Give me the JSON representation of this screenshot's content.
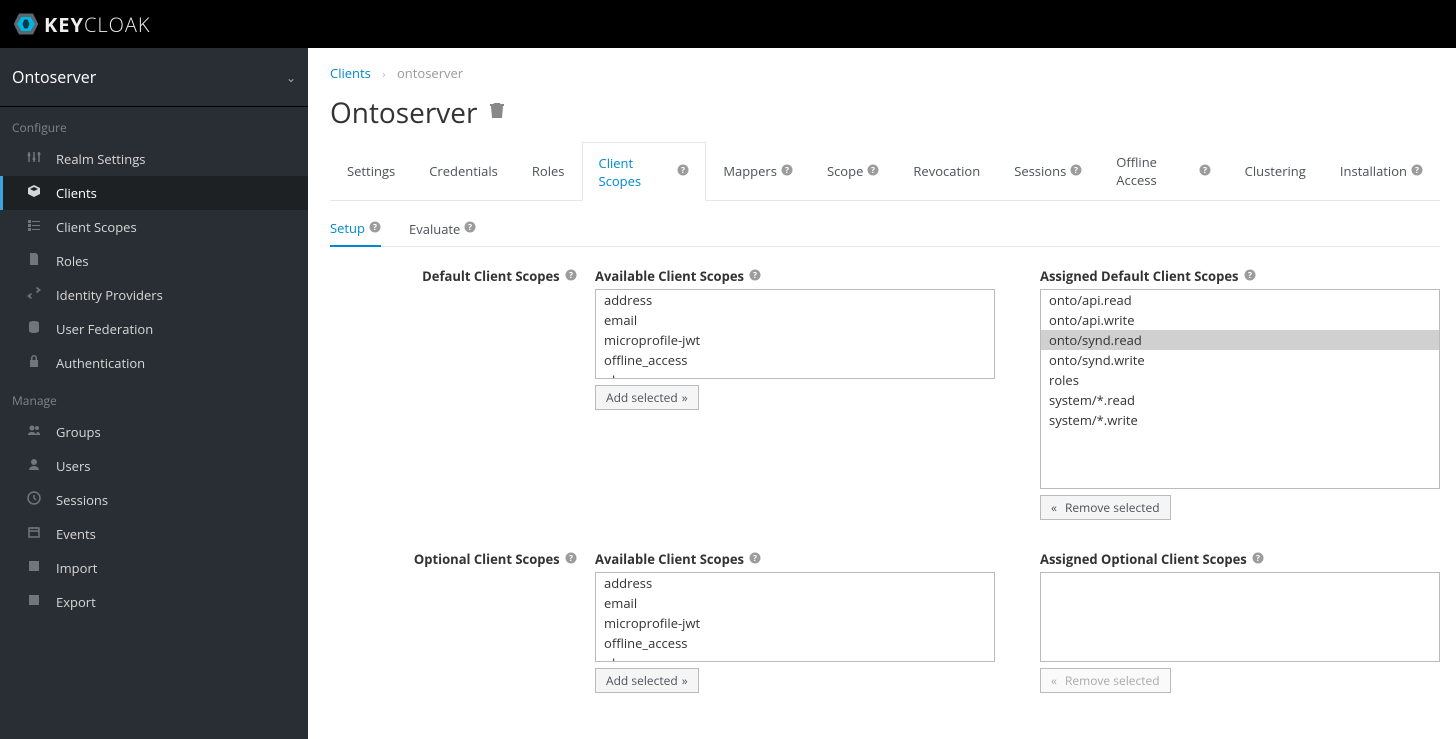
{
  "brand": {
    "text": "KEYCLOAK",
    "bold_prefix_len": 3
  },
  "realm_selector": "Ontoserver",
  "sidebar": {
    "sections": [
      {
        "label": "Configure",
        "items": [
          {
            "label": "Realm Settings",
            "icon": "sliders"
          },
          {
            "label": "Clients",
            "icon": "cube",
            "active": true
          },
          {
            "label": "Client Scopes",
            "icon": "list"
          },
          {
            "label": "Roles",
            "icon": "file"
          },
          {
            "label": "Identity Providers",
            "icon": "exchange"
          },
          {
            "label": "User Federation",
            "icon": "db"
          },
          {
            "label": "Authentication",
            "icon": "lock"
          }
        ]
      },
      {
        "label": "Manage",
        "items": [
          {
            "label": "Groups",
            "icon": "users"
          },
          {
            "label": "Users",
            "icon": "user"
          },
          {
            "label": "Sessions",
            "icon": "clock"
          },
          {
            "label": "Events",
            "icon": "calendar"
          },
          {
            "label": "Import",
            "icon": "import"
          },
          {
            "label": "Export",
            "icon": "export"
          }
        ]
      }
    ]
  },
  "breadcrumb": {
    "parent": "Clients",
    "current": "ontoserver"
  },
  "page_title": "Ontoserver",
  "tabs": [
    {
      "label": "Settings"
    },
    {
      "label": "Credentials"
    },
    {
      "label": "Roles"
    },
    {
      "label": "Client Scopes",
      "help": true,
      "active": true
    },
    {
      "label": "Mappers",
      "help": true
    },
    {
      "label": "Scope",
      "help": true
    },
    {
      "label": "Revocation"
    },
    {
      "label": "Sessions",
      "help": true
    },
    {
      "label": "Offline Access",
      "help": true
    },
    {
      "label": "Clustering"
    },
    {
      "label": "Installation",
      "help": true
    }
  ],
  "subtabs": [
    {
      "label": "Setup",
      "help": true,
      "active": true
    },
    {
      "label": "Evaluate",
      "help": true
    }
  ],
  "scope_rows": [
    {
      "label": "Default Client Scopes",
      "available": {
        "title": "Available Client Scopes",
        "options": [
          "address",
          "email",
          "microprofile-jwt",
          "offline_access",
          "phone"
        ],
        "button": "Add selected",
        "tall": false
      },
      "assigned": {
        "title": "Assigned Default Client Scopes",
        "options": [
          "onto/api.read",
          "onto/api.write",
          "onto/synd.read",
          "onto/synd.write",
          "roles",
          "system/*.read",
          "system/*.write"
        ],
        "selected_index": 2,
        "button": "Remove selected",
        "tall": true
      }
    },
    {
      "label": "Optional Client Scopes",
      "available": {
        "title": "Available Client Scopes",
        "options": [
          "address",
          "email",
          "microprofile-jwt",
          "offline_access",
          "phone"
        ],
        "button": "Add selected",
        "tall": false
      },
      "assigned": {
        "title": "Assigned Optional Client Scopes",
        "options": [],
        "button": "Remove selected",
        "tall": false,
        "disabled": true
      }
    }
  ]
}
